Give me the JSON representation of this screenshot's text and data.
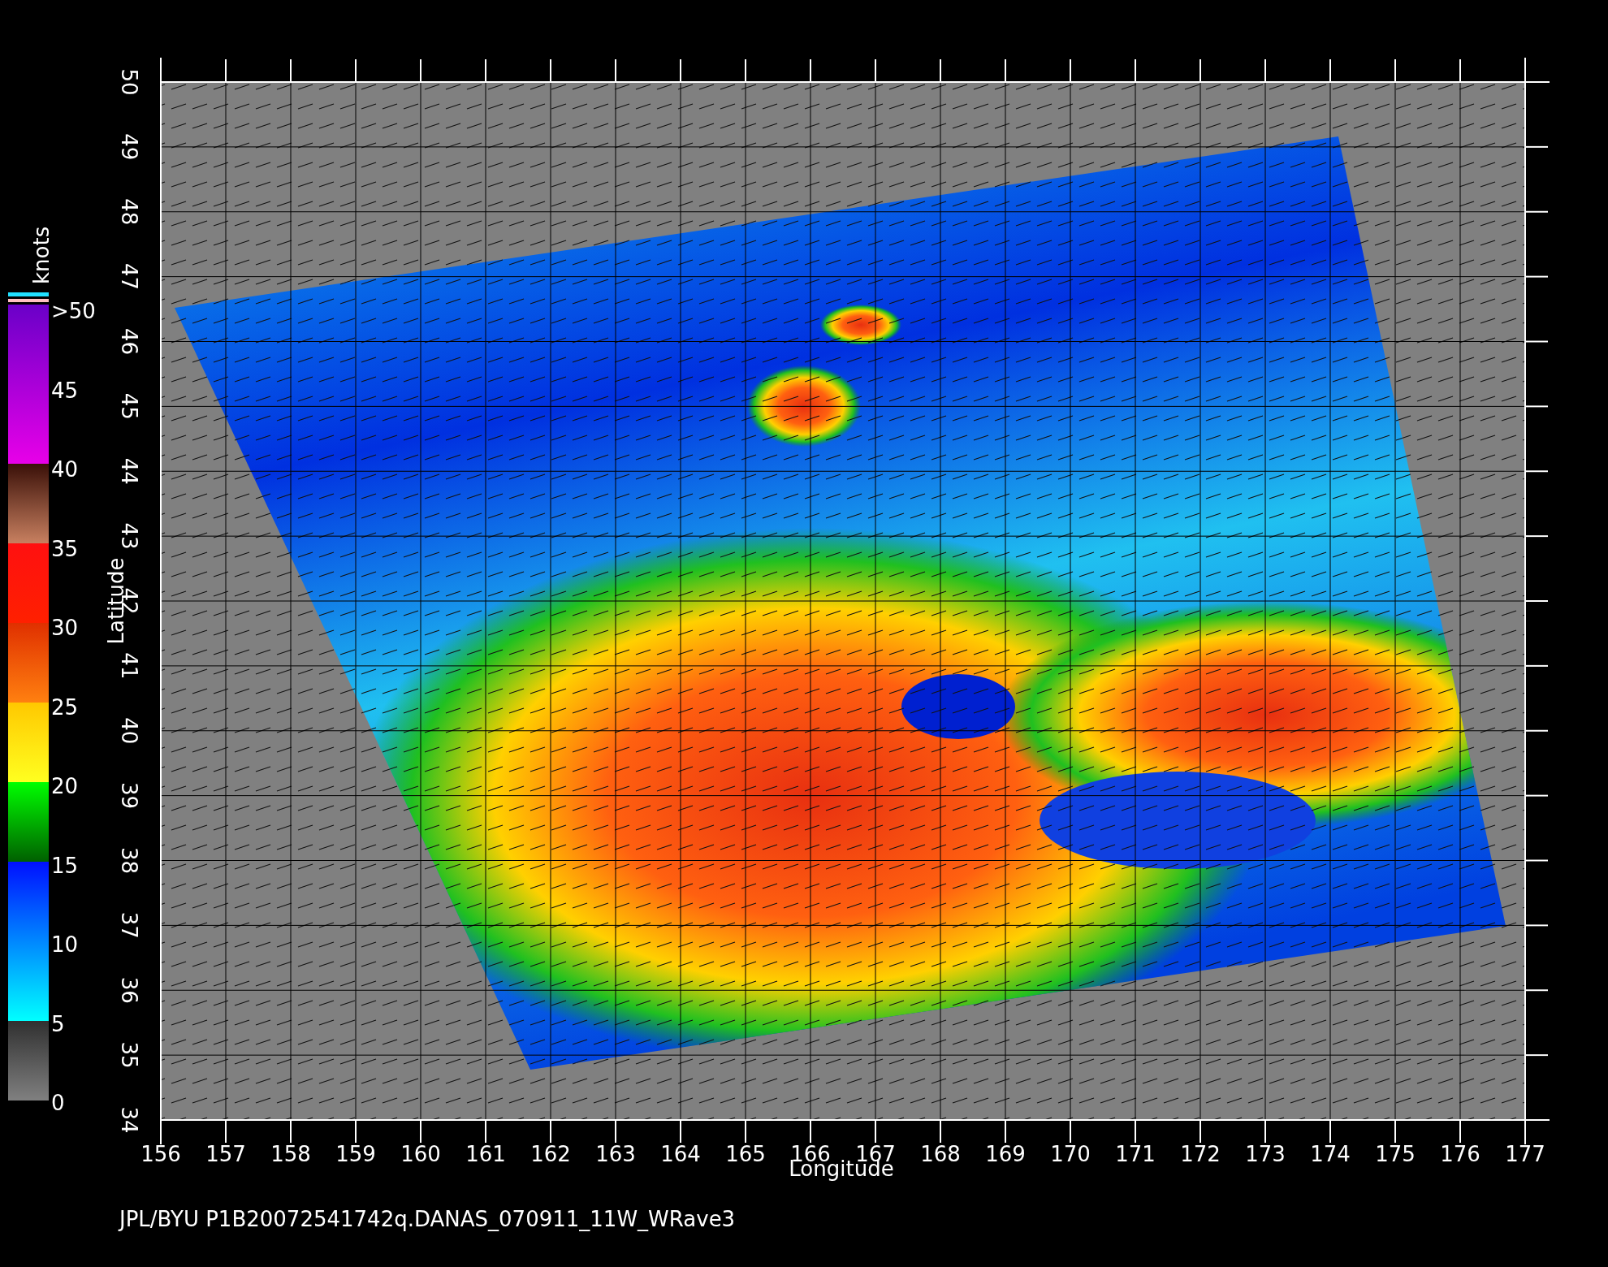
{
  "colorbar": {
    "unit": "knots",
    "labels": [
      ">50",
      "45",
      "40",
      "35",
      "30",
      "25",
      "20",
      "15",
      "10",
      "5",
      "0"
    ]
  },
  "map": {
    "y_label": "Latitude",
    "x_label": "Longitude",
    "latitudes": [
      "50",
      "49",
      "48",
      "47",
      "46",
      "45",
      "44",
      "43",
      "42",
      "41",
      "40",
      "39",
      "38",
      "37",
      "36",
      "35",
      "34"
    ],
    "longitudes": [
      "156",
      "157",
      "158",
      "159",
      "160",
      "161",
      "162",
      "163",
      "164",
      "165",
      "166",
      "167",
      "168",
      "169",
      "170",
      "171",
      "172",
      "173",
      "174",
      "175",
      "176",
      "177"
    ]
  },
  "footer": "JPL/BYU  P1B20072541742q.DANAS_070911_11W_WRave3"
}
